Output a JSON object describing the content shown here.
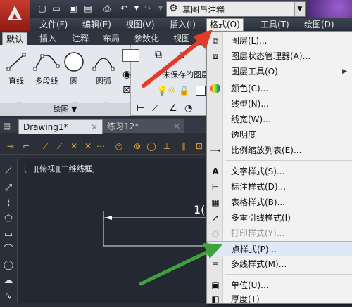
{
  "app": {
    "workspace": "草图与注释"
  },
  "menubar": {
    "items": [
      "文件(F)",
      "编辑(E)",
      "视图(V)",
      "插入(I)",
      "格式(O)",
      "工具(T)",
      "绘图(D)"
    ]
  },
  "ribbon_tabs": [
    "默认",
    "插入",
    "注释",
    "布局",
    "参数化",
    "视图"
  ],
  "draw_panel": {
    "tools": [
      "直线",
      "多段线",
      "圆",
      "圆弧"
    ],
    "footer": "绘图 ▼"
  },
  "layer_panel": {
    "unsaved_state": "未保存的图层状态"
  },
  "doc_tabs": [
    "Drawing1*",
    "练习12*"
  ],
  "viewport": {
    "label": "[−][俯视][二维线框]",
    "dimension_text": "1("
  },
  "format_menu": {
    "items": [
      {
        "label": "图层(L)...",
        "icon": "layers-icon"
      },
      {
        "label": "图层状态管理器(A)...",
        "icon": "layer-state-icon"
      },
      {
        "label": "图层工具(O)",
        "icon": "",
        "submenu": true
      },
      {
        "label": "颜色(C)...",
        "icon": "color-wheel-icon"
      },
      {
        "label": "线型(N)...",
        "icon": ""
      },
      {
        "label": "线宽(W)...",
        "icon": ""
      },
      {
        "label": "透明度",
        "icon": ""
      },
      {
        "label": "比例缩放列表(E)...",
        "icon": "scale-list-icon"
      },
      {
        "label": "文字样式(S)...",
        "icon": "text-style-icon"
      },
      {
        "label": "标注样式(D)...",
        "icon": "dim-style-icon"
      },
      {
        "label": "表格样式(B)...",
        "icon": "table-style-icon"
      },
      {
        "label": "多重引线样式(I)",
        "icon": "mleader-style-icon"
      },
      {
        "label": "打印样式(Y)...",
        "icon": "plot-style-icon",
        "disabled": true
      },
      {
        "label": "点样式(P)...",
        "icon": "point-style-icon",
        "highlighted": true
      },
      {
        "label": "多线样式(M)...",
        "icon": "mline-style-icon"
      },
      {
        "label": "单位(U)...",
        "icon": "units-icon"
      },
      {
        "label": "厚度(T)",
        "icon": "thickness-icon"
      }
    ]
  },
  "colors": {
    "accent_arrow_red": "#e23b2a",
    "accent_arrow_green": "#3fa33a",
    "menu_highlight": "#dfe8f5"
  }
}
